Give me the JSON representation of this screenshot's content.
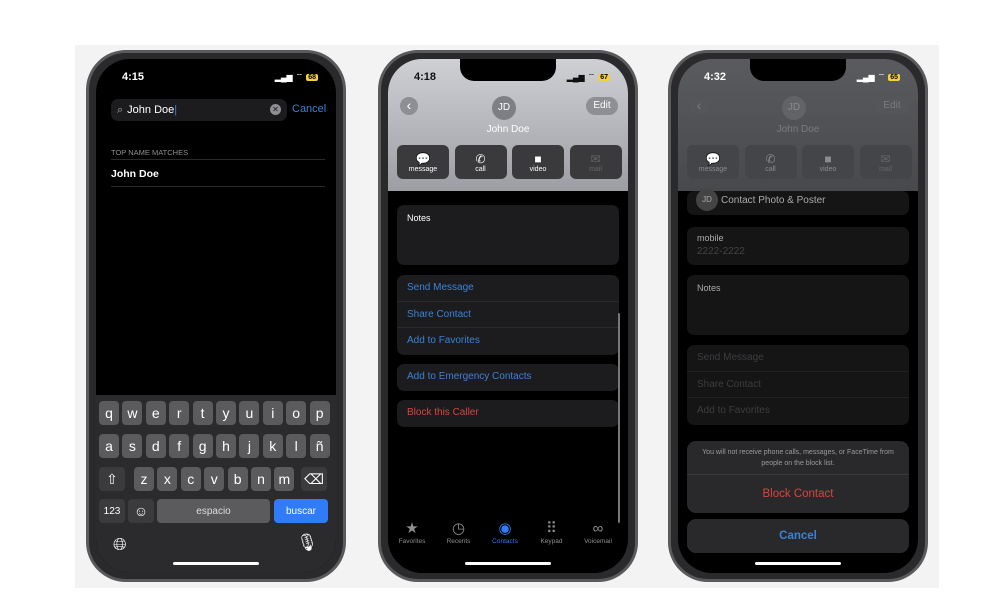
{
  "phone1": {
    "time": "4:15",
    "battery": "68",
    "search": {
      "value": "John Doe",
      "cancel": "Cancel"
    },
    "section_header": "TOP NAME MATCHES",
    "results": [
      "John Doe"
    ],
    "keyboard": {
      "row1": [
        "q",
        "w",
        "e",
        "r",
        "t",
        "y",
        "u",
        "i",
        "o",
        "p"
      ],
      "row2": [
        "a",
        "s",
        "d",
        "f",
        "g",
        "h",
        "j",
        "k",
        "l",
        "ñ"
      ],
      "row3": [
        "z",
        "x",
        "c",
        "v",
        "b",
        "n",
        "m"
      ],
      "numbers": "123",
      "space": "espacio",
      "search": "buscar"
    }
  },
  "phone2": {
    "time": "4:18",
    "battery": "67",
    "back": "‹",
    "edit": "Edit",
    "initials": "JD",
    "name": "John Doe",
    "actions": [
      {
        "label": "message",
        "icon": "💬"
      },
      {
        "label": "call",
        "icon": "✆"
      },
      {
        "label": "video",
        "icon": "■"
      },
      {
        "label": "mail",
        "icon": "✉"
      }
    ],
    "notes_label": "Notes",
    "links": [
      "Send Message",
      "Share Contact",
      "Add to Favorites"
    ],
    "emergency": "Add to Emergency Contacts",
    "block": "Block this Caller",
    "tabs": [
      {
        "label": "Favorites",
        "icon": "★"
      },
      {
        "label": "Recents",
        "icon": "◷"
      },
      {
        "label": "Contacts",
        "icon": "◉"
      },
      {
        "label": "Keypad",
        "icon": "⠿"
      },
      {
        "label": "Voicemail",
        "icon": "∞"
      }
    ],
    "active_tab": "Contacts"
  },
  "phone3": {
    "time": "4:32",
    "battery": "65",
    "edit": "Edit",
    "initials": "JD",
    "name": "John Doe",
    "photo_label": "Contact Photo & Poster",
    "mobile_label": "mobile",
    "mobile_value": "2222-2222",
    "notes_label": "Notes",
    "links": [
      "Send Message",
      "Share Contact",
      "Add to Favorites"
    ],
    "sheet": {
      "message": "You will not receive phone calls, messages, or FaceTime from people on the block list.",
      "block": "Block Contact",
      "cancel": "Cancel"
    }
  },
  "colors": {
    "accent": "#3b82d6",
    "destructive": "#d64541",
    "key_search": "#2f7cf6",
    "battery": "#f4d13c"
  }
}
